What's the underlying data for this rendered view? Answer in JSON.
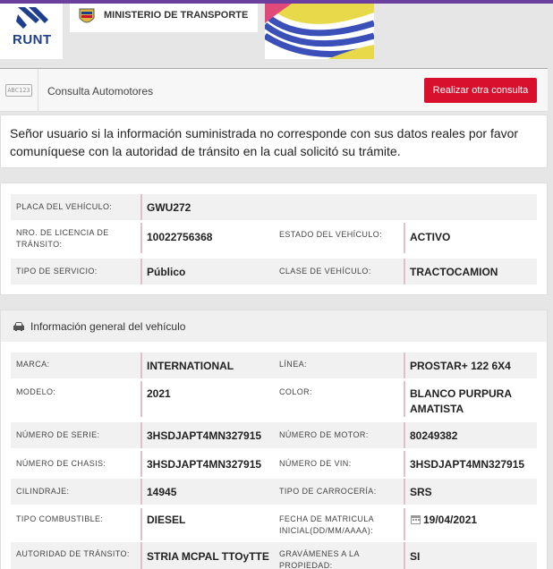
{
  "header": {
    "runt_logo_text": "RUNT",
    "ministerio_text": "MINISTERIO DE TRANSPORTE"
  },
  "consulta": {
    "icon_text": "ABC123",
    "title": "Consulta Automotores",
    "button_label": "Realizar otra consulta"
  },
  "notice": {
    "text": "Señor usuario si la información suministrada no corresponde con sus datos reales por favor comuníquese con la autoridad de tránsito en la cual solicitó su trámite."
  },
  "summary": {
    "placa_label": "PLACA DEL VEHÍCULO:",
    "placa_value": "GWU272",
    "licencia_label": "NRO. DE LICENCIA DE TRÁNSITO:",
    "licencia_value": "10022756368",
    "estado_label": "ESTADO DEL VEHÍCULO:",
    "estado_value": "ACTIVO",
    "servicio_label": "TIPO DE SERVICIO:",
    "servicio_value": "Público",
    "clase_label": "CLASE DE VEHÍCULO:",
    "clase_value": "TRACTOCAMION"
  },
  "general": {
    "section_title": "Información general del vehículo",
    "marca_label": "MARCA:",
    "marca_value": "INTERNATIONAL",
    "linea_label": "LÍNEA:",
    "linea_value": "PROSTAR+ 122 6X4",
    "modelo_label": "MODELO:",
    "modelo_value": "2021",
    "color_label": "COLOR:",
    "color_value": "BLANCO PURPURA AMATISTA",
    "serie_label": "NÚMERO DE SERIE:",
    "serie_value": "3HSDJAPT4MN327915",
    "motor_label": "NÚMERO DE MOTOR:",
    "motor_value": "80249382",
    "chasis_label": "NÚMERO DE CHASIS:",
    "chasis_value": "3HSDJAPT4MN327915",
    "vin_label": "NÚMERO DE VIN:",
    "vin_value": "3HSDJAPT4MN327915",
    "cilindraje_label": "CILINDRAJE:",
    "cilindraje_value": "14945",
    "carroceria_label": "TIPO DE CARROCERÍA:",
    "carroceria_value": "SRS",
    "combustible_label": "TIPO COMBUSTIBLE:",
    "combustible_value": "DIESEL",
    "matricula_label": "FECHA DE MATRICULA INICIAL(DD/MM/AAAA):",
    "matricula_value": "19/04/2021",
    "autoridad_label": "AUTORIDAD DE TRÁNSITO:",
    "autoridad_value": "STRIA MCPAL TTOyTTE",
    "gravamenes_label": "GRAVÁMENES A LA PROPIEDAD:",
    "gravamenes_value": "SI"
  },
  "colors": {
    "accent_red": "#d8102d",
    "runt_blue": "#1d3f8e",
    "top_line": "#6b3fa0"
  }
}
